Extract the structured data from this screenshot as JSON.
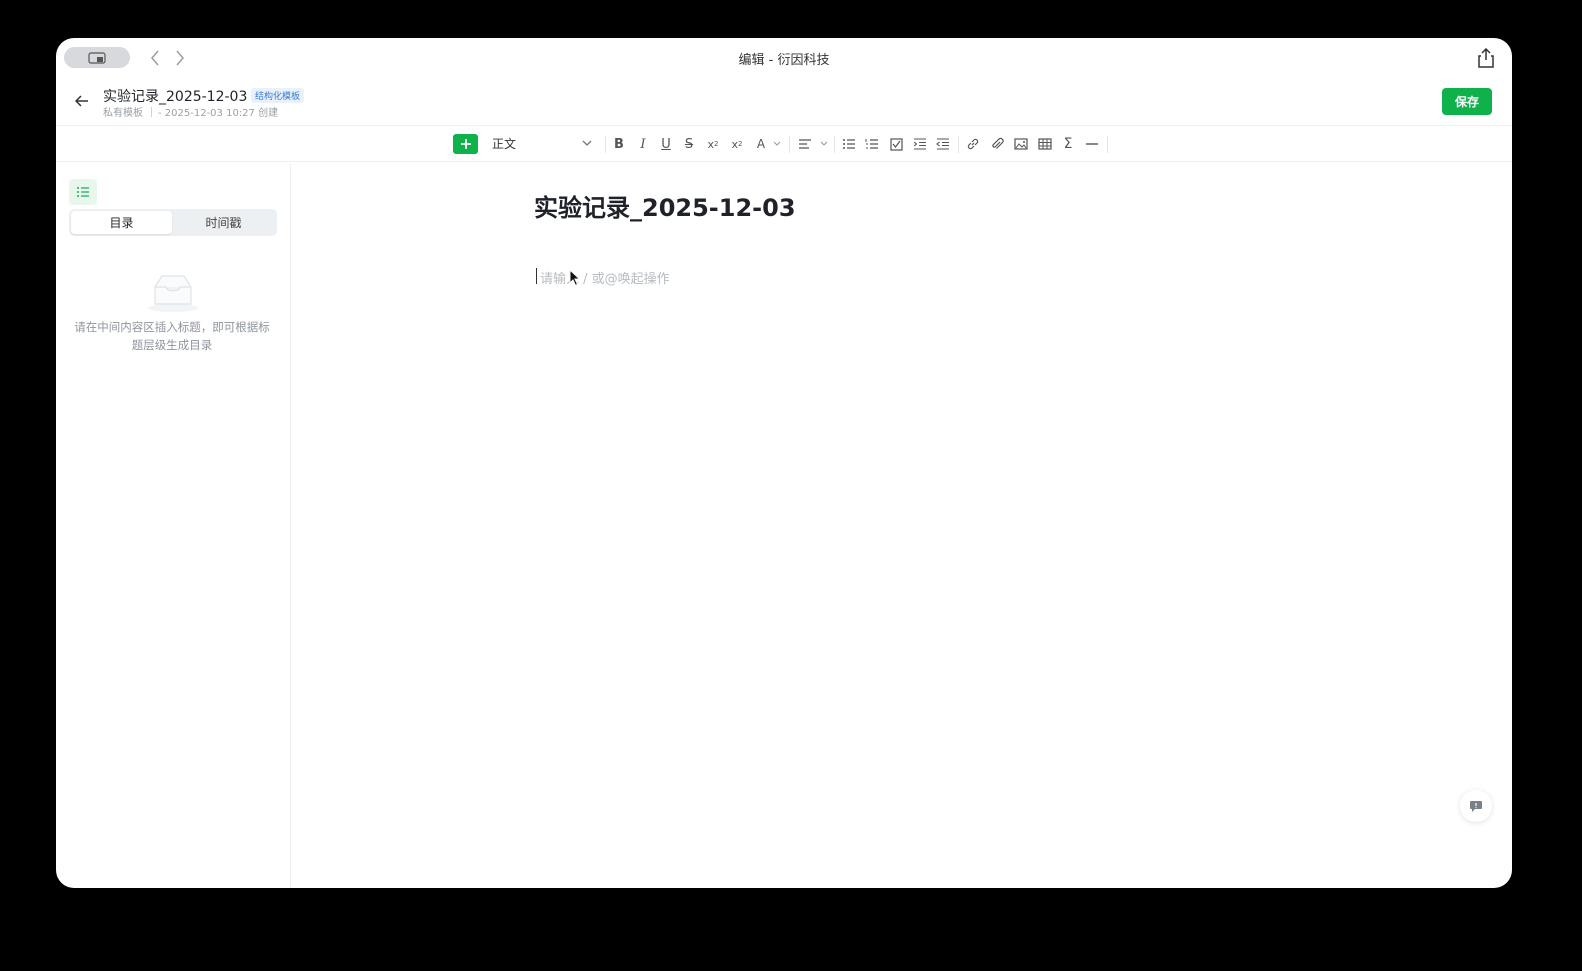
{
  "window": {
    "title": "编辑 - 衍因科技"
  },
  "doc": {
    "title": "实验记录_2025-12-03",
    "badge": "结构化模板",
    "scope": "私有模板",
    "meta": "- 2025-12-03 10:27 创建",
    "save_label": "保存"
  },
  "toolbar": {
    "paragraph_style": "正文",
    "icons": [
      "add-icon",
      "bold-icon",
      "italic-icon",
      "underline-icon",
      "strikethrough-icon",
      "superscript-icon",
      "subscript-icon",
      "font-color-icon",
      "align-icon",
      "bullet-list-icon",
      "numbered-list-icon",
      "checklist-icon",
      "indent-icon",
      "outdent-icon",
      "link-icon",
      "attachment-icon",
      "image-icon",
      "table-icon",
      "formula-icon",
      "divider-icon"
    ]
  },
  "sidebar": {
    "tabs": [
      "目录",
      "时间戳"
    ],
    "active_tab": "目录",
    "empty_text": "请在中间内容区插入标题，即可根据标题层级生成目录"
  },
  "editor": {
    "title": "实验记录_2025-12-03",
    "placeholder": "请输入 / 或@唤起操作"
  },
  "colors": {
    "accent": "#0fb14b",
    "badge": "#3a7bd5"
  }
}
